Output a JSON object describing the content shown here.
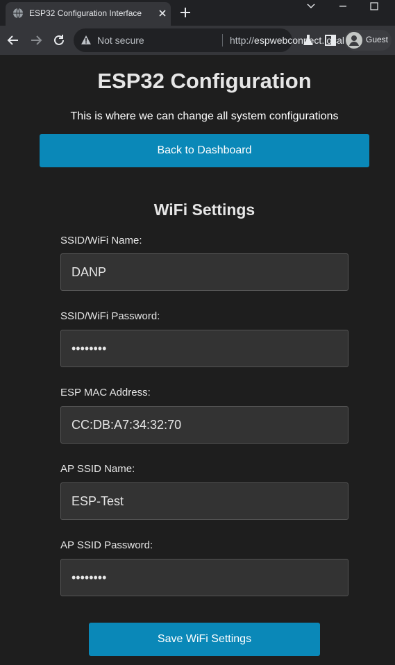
{
  "browser": {
    "tab_title": "ESP32 Configuration Interface",
    "security_label": "Not secure",
    "url_scheme": "http://",
    "url_host": "espwebconnect.local...",
    "profile_label": "Guest"
  },
  "page": {
    "title": "ESP32 Configuration",
    "subtitle": "This is where we can change all system configurations",
    "back_button": "Back to Dashboard",
    "section_title": "WiFi Settings",
    "fields": [
      {
        "label": "SSID/WiFi Name:",
        "value": "DANP"
      },
      {
        "label": "SSID/WiFi Password:",
        "value": "••••••••"
      },
      {
        "label": "ESP MAC Address:",
        "value": "CC:DB:A7:34:32:70"
      },
      {
        "label": "AP SSID Name:",
        "value": "ESP-Test"
      },
      {
        "label": "AP SSID Password:",
        "value": "••••••••"
      }
    ],
    "save_button": "Save WiFi Settings"
  },
  "colors": {
    "accent": "#0a88b8",
    "background": "#1e1e1e",
    "input_bg": "#333333"
  }
}
